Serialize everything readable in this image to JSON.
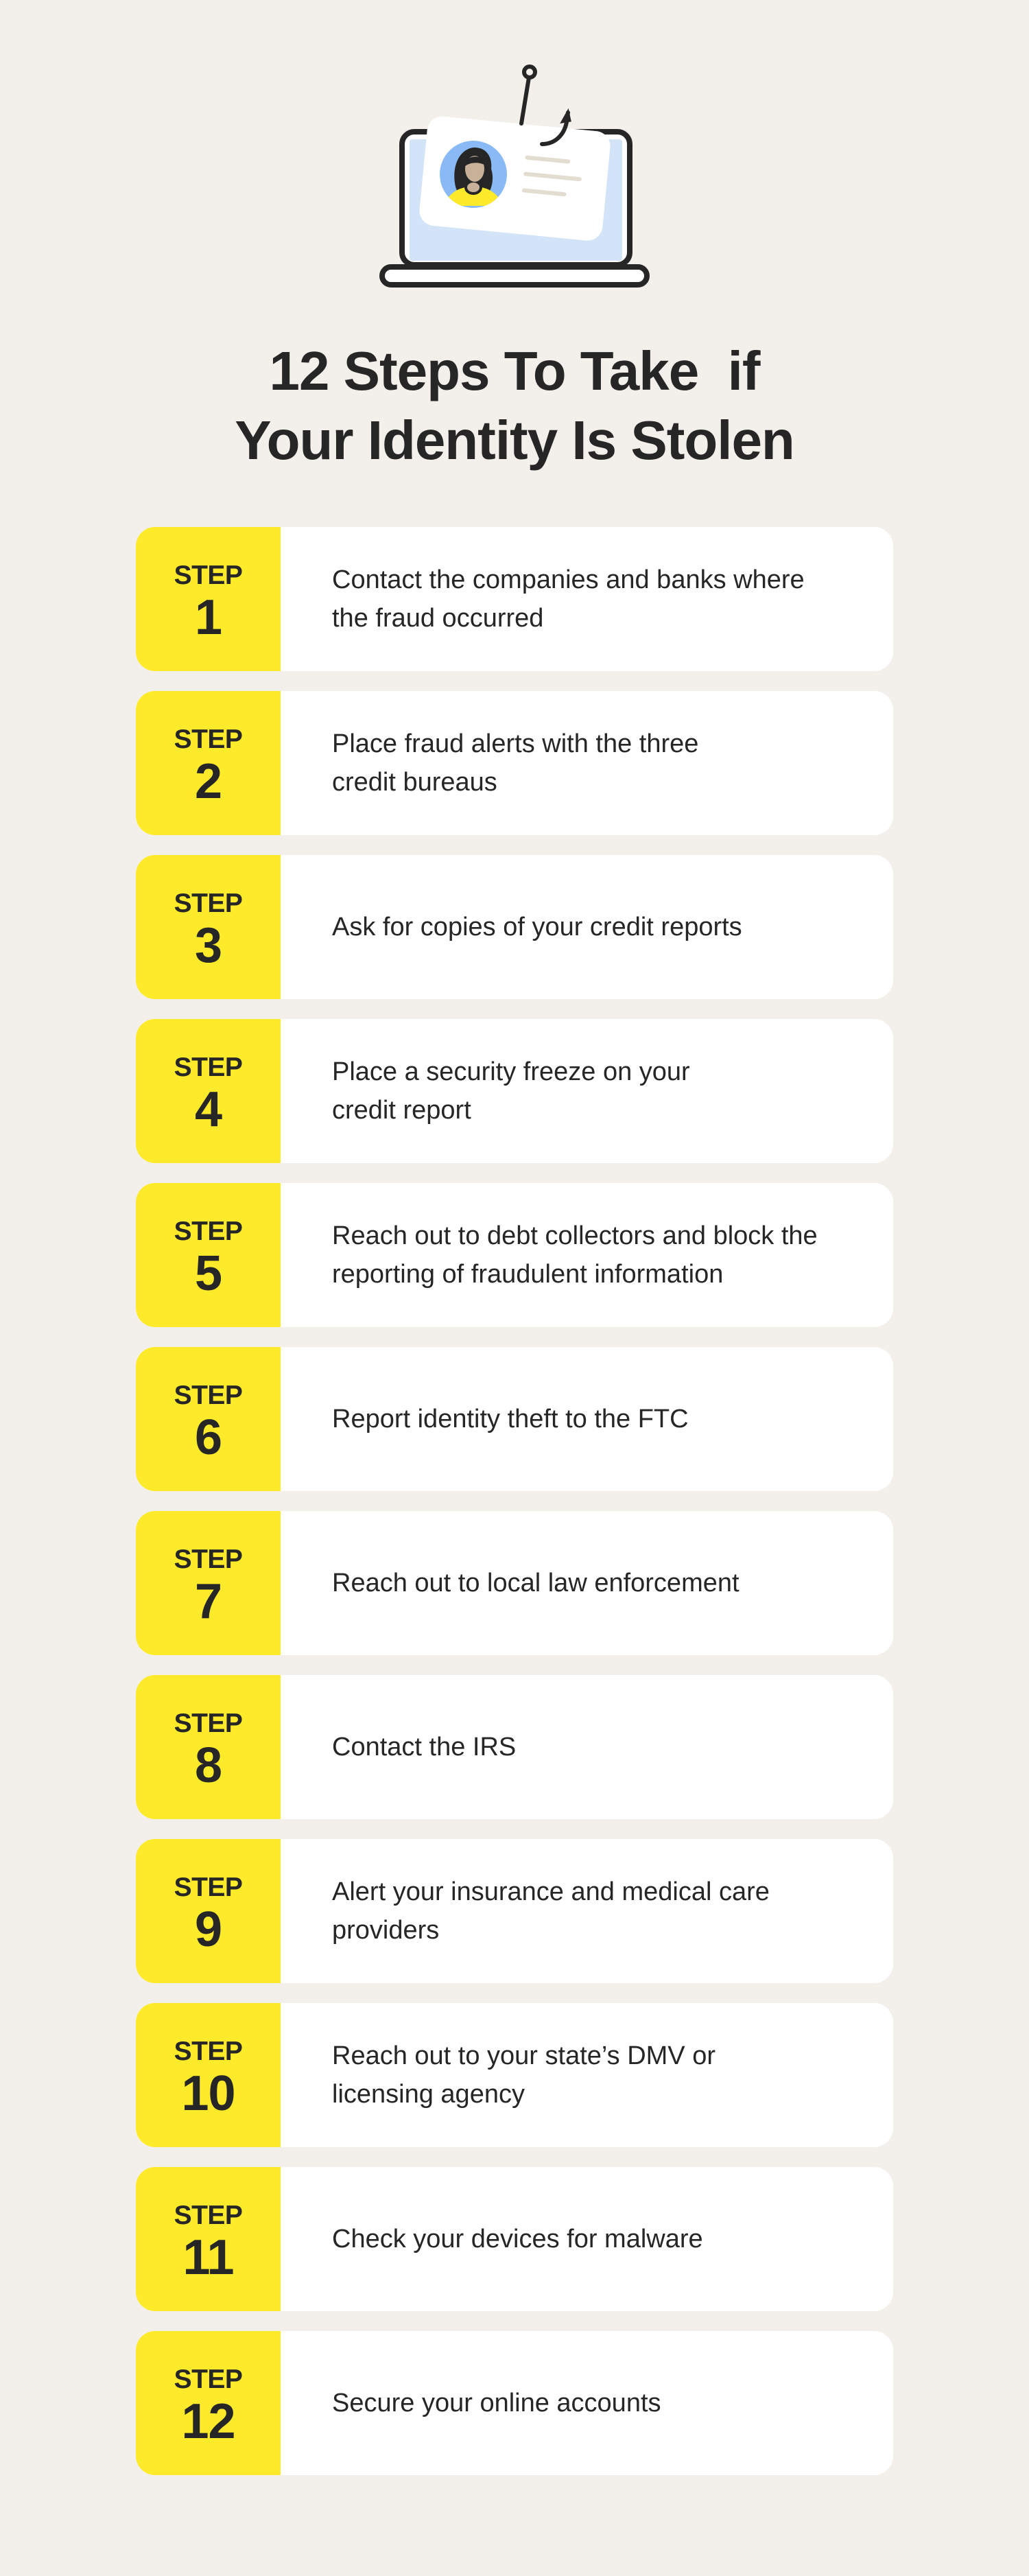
{
  "illustration": {
    "name": "laptop-with-hooked-id-card",
    "colors": {
      "outline": "#262626",
      "screen": "#D3E3F8",
      "card": "#FFFFFF",
      "avatar_bg": "#8ABAF5",
      "skin": "#C7B299",
      "shirt": "#FDEB2B",
      "card_lines": "#E3DCD0"
    }
  },
  "title": {
    "line1": "12 Steps To Take  if",
    "line2": "Your Identity Is Stolen"
  },
  "colors": {
    "background": "#F3F0EB",
    "accent_yellow": "#FDEB2B",
    "card": "#FFFFFF",
    "text": "#262626"
  },
  "steps": [
    {
      "label": "STEP",
      "number": "1",
      "text": "Contact the companies and banks where the fraud occurred"
    },
    {
      "label": "STEP",
      "number": "2",
      "text": "Place fraud alerts with the three credit bureaus"
    },
    {
      "label": "STEP",
      "number": "3",
      "text": "Ask for copies of your credit reports"
    },
    {
      "label": "STEP",
      "number": "4",
      "text": "Place a security freeze on your credit report"
    },
    {
      "label": "STEP",
      "number": "5",
      "text": "Reach out to debt collectors and block the reporting of fraudulent information"
    },
    {
      "label": "STEP",
      "number": "6",
      "text": "Report identity theft to the FTC"
    },
    {
      "label": "STEP",
      "number": "7",
      "text": "Reach out to local law enforcement"
    },
    {
      "label": "STEP",
      "number": "8",
      "text": "Contact the IRS"
    },
    {
      "label": "STEP",
      "number": "9",
      "text": "Alert your insurance and medical care providers"
    },
    {
      "label": "STEP",
      "number": "10",
      "text": "Reach out to your state’s DMV or licensing agency"
    },
    {
      "label": "STEP",
      "number": "11",
      "text": "Check your devices for malware"
    },
    {
      "label": "STEP",
      "number": "12",
      "text": "Secure your online accounts"
    }
  ]
}
